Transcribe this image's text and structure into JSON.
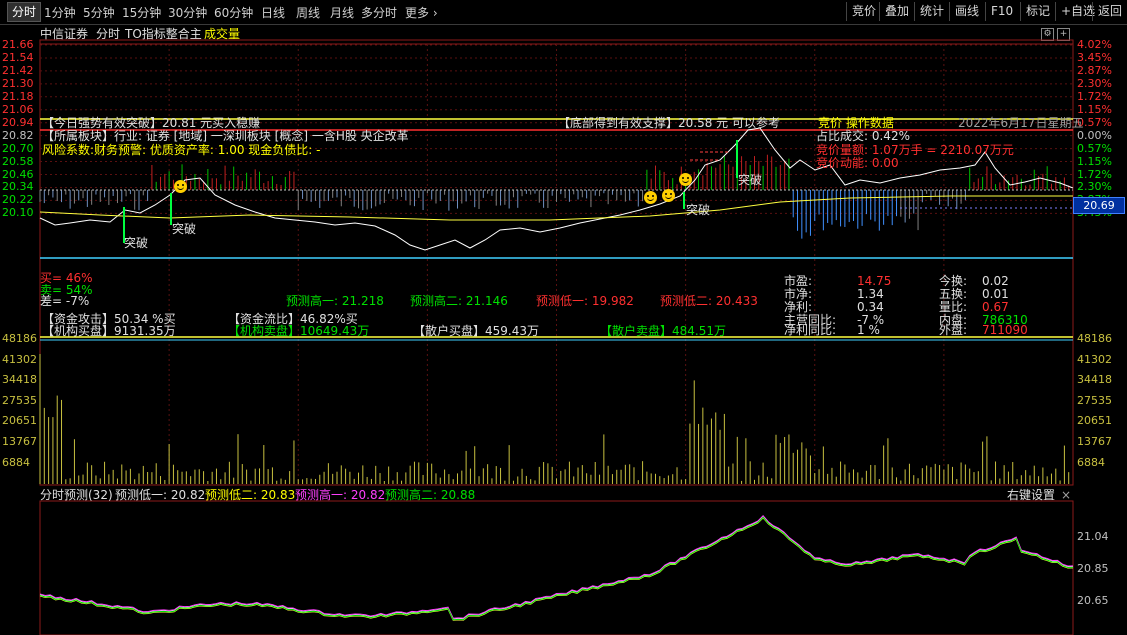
{
  "toolbar": {
    "tabs": [
      "分时",
      "1分钟",
      "5分钟",
      "15分钟",
      "30分钟",
      "60分钟",
      "日线",
      "周线",
      "月线",
      "多分时",
      "更多"
    ],
    "right_buttons": [
      "竞价",
      "叠加",
      "统计",
      "画线",
      "F10",
      "标记",
      "+自选",
      "返回"
    ]
  },
  "header": {
    "broker": "中信证券",
    "mode": "分时",
    "indicator": "TO指标整合主",
    "volume_label": "成交量"
  },
  "price_axis": {
    "left": [
      "21.66",
      "21.54",
      "21.42",
      "21.30",
      "21.18",
      "21.06",
      "20.94",
      "20.82",
      "20.70",
      "20.58",
      "20.46",
      "20.34",
      "20.22",
      "20.10"
    ],
    "right": [
      "4.02%",
      "3.45%",
      "2.87%",
      "2.30%",
      "1.72%",
      "1.15%",
      "0.57%",
      "0.00%",
      "0.57%",
      "1.15%",
      "1.72%",
      "2.30%",
      "2.87%",
      "3.45%"
    ],
    "current_price": "20.69"
  },
  "volume_axis": {
    "left": [
      "48186",
      "41302",
      "34418",
      "27535",
      "20651",
      "13767",
      "6884"
    ],
    "right": [
      "48186",
      "41302",
      "34418",
      "27535",
      "20651",
      "13767",
      "6884"
    ]
  },
  "forecast_axis": {
    "right": [
      "21.04",
      "20.85",
      "20.65"
    ]
  },
  "annotations": {
    "today_strong": "【今日强势有效突破】20.81 元买入稳赚",
    "bottom_support": "【底部得到有效支撑】20.58 元 可以参考",
    "auction": "竞价 操作数据",
    "date": "2022年6月17日星期五",
    "sector": "【所属板块】行业: 证券 [地域] 一深圳板块 [概念] 一含H股 央企改革",
    "risk": "风险系数:财务预警: 优质资产率: 1.00 现金负债比: -",
    "auction_ratio": "占比成交: 0.42%",
    "auction_amount": "竞价量额: 1.07万手 = 2210.07万元",
    "auction_power": "竞价动能: 0.00",
    "breakthrough": "突破"
  },
  "indicators": {
    "buy": "买= 46%",
    "sell": "卖= 54%",
    "diff": "差= -7%",
    "pred_high1": "预测高一:  21.218",
    "pred_high2": "预测高二:  21.146",
    "pred_low1": "预测低一:  19.982",
    "pred_low2": "预测低二:  20.433",
    "fund_attack": "【资金攻击】50.34 %买",
    "fund_flow": "【资金流比】46.82%买",
    "inst_buy": "【机构买盘】9131.35万",
    "inst_sell": "【机构卖盘】10649.43万",
    "retail_buy": "【散户买盘】459.43万",
    "retail_sell": "【散户卖盘】484.51万"
  },
  "stats": {
    "pe_label": "市盈:",
    "pe": "14.75",
    "pb_label": "市净:",
    "pb": "1.34",
    "np_label": "净利:",
    "np": "0.34",
    "rev_label": "主营同比:",
    "rev": "-7 %",
    "npg_label": "净利同比:",
    "npg": "1 %",
    "turn_label": "今换:",
    "turn": "0.02",
    "turn5_label": "五换:",
    "turn5": "0.01",
    "vr_label": "量比:",
    "vr": "0.67",
    "inner_label": "内盘:",
    "inner": "786310",
    "outer_label": "外盘:",
    "outer": "711090"
  },
  "forecast": {
    "title": "分时预测(32)",
    "low1": "预测低一: 20.82",
    "low2": "预测低二: 20.83",
    "high1": "预测高一: 20.82",
    "high2": "预测高二: 20.88",
    "settings": "右键设置",
    "close": "×"
  },
  "colors": {
    "up": "#ff3030",
    "down": "#00e000",
    "avg": "#ffff00",
    "price": "#ffffff",
    "volume": "#c8c040",
    "cyan": "#40d0ff"
  }
}
